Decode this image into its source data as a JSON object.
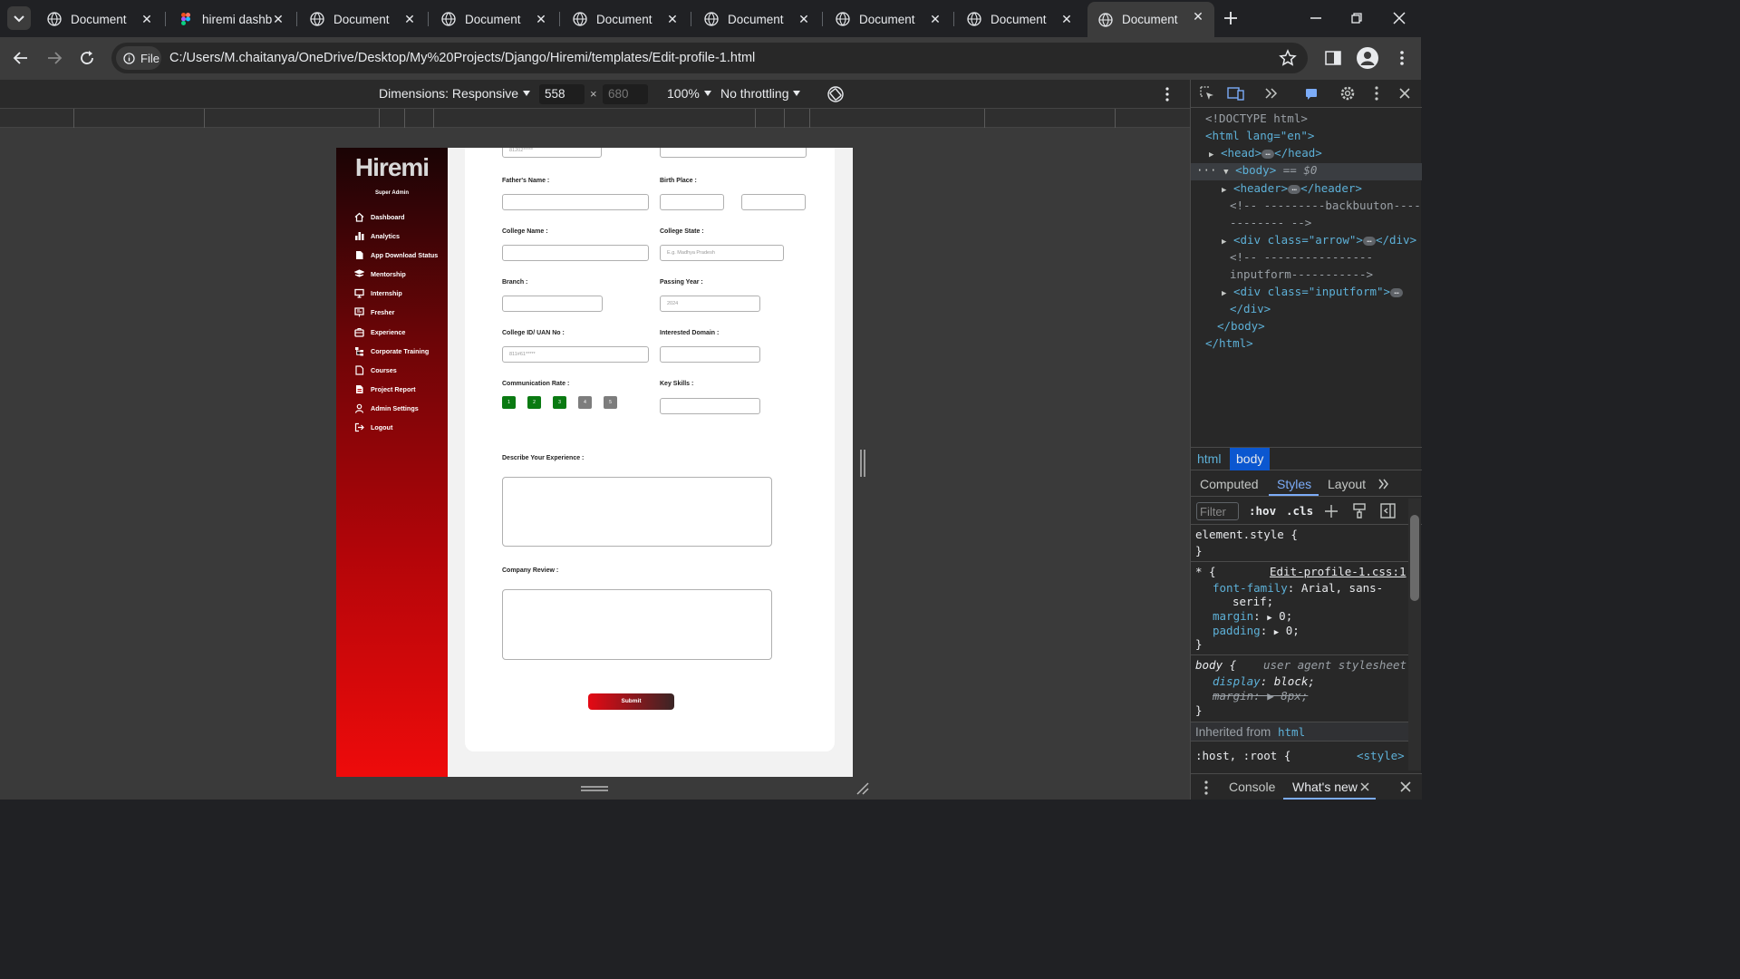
{
  "browser": {
    "tabs": [
      {
        "label": "Document",
        "icon": "globe-icon"
      },
      {
        "label": "hiremi dashb",
        "icon": "figma-icon"
      },
      {
        "label": "Document",
        "icon": "globe-icon"
      },
      {
        "label": "Document",
        "icon": "globe-icon"
      },
      {
        "label": "Document",
        "icon": "globe-icon"
      },
      {
        "label": "Document",
        "icon": "globe-icon"
      },
      {
        "label": "Document",
        "icon": "globe-icon"
      },
      {
        "label": "Document",
        "icon": "globe-icon"
      },
      {
        "label": "Document",
        "icon": "globe-icon",
        "active": true
      }
    ],
    "site_chip": "File",
    "url": "C:/Users/M.chaitanya/OneDrive/Desktop/My%20Projects/Django/Hiremi/templates/Edit-profile-1.html"
  },
  "device_toolbar": {
    "dimensions": "Dimensions: Responsive",
    "width": "558",
    "height": "680",
    "zoom": "100%",
    "throttling": "No throttling"
  },
  "app": {
    "logo": "Hiremi",
    "role": "Super Admin",
    "accent_color": "#e50914",
    "nav": [
      {
        "label": "Dashboard",
        "icon": "home-icon"
      },
      {
        "label": "Analytics",
        "icon": "bar-chart-icon"
      },
      {
        "label": "App Download Status",
        "icon": "file-icon"
      },
      {
        "label": "Mentorship",
        "icon": "layers-icon"
      },
      {
        "label": "Internship",
        "icon": "monitor-icon"
      },
      {
        "label": "Fresher",
        "icon": "presentation-icon"
      },
      {
        "label": "Experience",
        "icon": "briefcase-icon"
      },
      {
        "label": "Corporate Training",
        "icon": "sitemap-icon"
      },
      {
        "label": "Courses",
        "icon": "document-icon"
      },
      {
        "label": "Project Report",
        "icon": "report-icon"
      },
      {
        "label": "Admin Settings",
        "icon": "user-icon"
      },
      {
        "label": "Logout",
        "icon": "logout-icon"
      }
    ],
    "form": {
      "top_left_value": "81202*****",
      "fathers_name_label": "Father's Name :",
      "birth_place_label": "Birth Place :",
      "college_name_label": "College Name :",
      "college_state_label": "College State :",
      "college_state_placeholder": "E.g. Madhya Pradesh",
      "branch_label": "Branch :",
      "passing_year_label": "Passing Year :",
      "passing_year_placeholder": "2024",
      "college_id_label": "College ID/ UAN No :",
      "college_id_value": "811#61*****",
      "interested_domain_label": "Interested Domain :",
      "communication_rate_label": "Communication Rate :",
      "rates": [
        {
          "label": "1",
          "selected": true
        },
        {
          "label": "2",
          "selected": true
        },
        {
          "label": "3",
          "selected": true
        },
        {
          "label": "4",
          "selected": false
        },
        {
          "label": "5",
          "selected": false
        }
      ],
      "key_skills_label": "Key Skills :",
      "describe_experience_label": "Describe Your Experience :",
      "company_review_label": "Company Review :",
      "submit_label": "Submit"
    }
  },
  "devtools": {
    "dom": {
      "doctype": "<!DOCTYPE html>",
      "html_open": "<html lang=\"en\">",
      "head": "<head>",
      "head_close": "</head>",
      "body": "<body>",
      "body_eq": "== $0",
      "header": "<header>",
      "header_close": "</header>",
      "comment_back_1": "<!-- ---------backbuuton----",
      "comment_back_2": "-------- -->",
      "div_arrow_open": "<div class=\"arrow\">",
      "div_close": "</div>",
      "comment_input_1": "<!-- ----------------",
      "comment_input_2": "inputform----------->",
      "div_inputform_open": "<div class=\"inputform\">",
      "div_close_2": "</div>",
      "body_close": "</body>",
      "html_close": "</html>"
    },
    "breadcrumbs": [
      "html",
      "body"
    ],
    "panel_tabs": [
      "Computed",
      "Styles",
      "Layout"
    ],
    "filter_placeholder": "Filter",
    "hov": ":hov",
    "cls": ".cls",
    "styles": {
      "element_style": "element.style {",
      "close_brace": "}",
      "star_rule": "* {",
      "star_source": "Edit-profile-1.css:1",
      "font_family_prop": "font-family",
      "font_family_val": "Arial, sans-",
      "font_family_val2": "serif;",
      "margin_prop": "margin",
      "margin_val": "0;",
      "padding_prop": "padding",
      "padding_val": "0;",
      "body_rule": "body {",
      "ua_label": "user agent stylesheet",
      "display_prop": "display",
      "display_val": "block;",
      "body_margin": "margin: ▶ 8px;",
      "inherited_label": "Inherited from",
      "inherited_tag": "html",
      "host_rule": ":host, :root {",
      "host_source": "<style>"
    },
    "drawer_tabs": [
      "Console",
      "What's new"
    ]
  }
}
